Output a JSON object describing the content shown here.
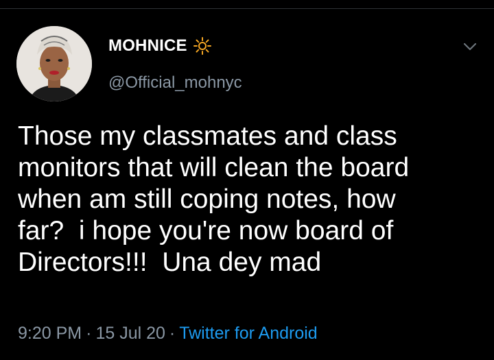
{
  "tweet": {
    "author": {
      "display_name": "MOHNICE",
      "handle": "@Official_mohnyc"
    },
    "text_lines": [
      "Those my classmates and class",
      "monitors that will clean the board",
      "when am still coping notes, how",
      "far?  i hope you're now board of",
      "Directors!!!  Una dey mad"
    ],
    "time": "9:20 PM",
    "separator": "·",
    "date": "15 Jul 20",
    "source": "Twitter for Android"
  },
  "colors": {
    "background": "#000000",
    "primary_text": "#ffffff",
    "secondary_text": "#8b98a5",
    "link": "#1d9bf0",
    "sun_icon": "#f5a623"
  },
  "icons": {
    "name_emoji": "sun-icon",
    "menu": "chevron-down-icon"
  }
}
